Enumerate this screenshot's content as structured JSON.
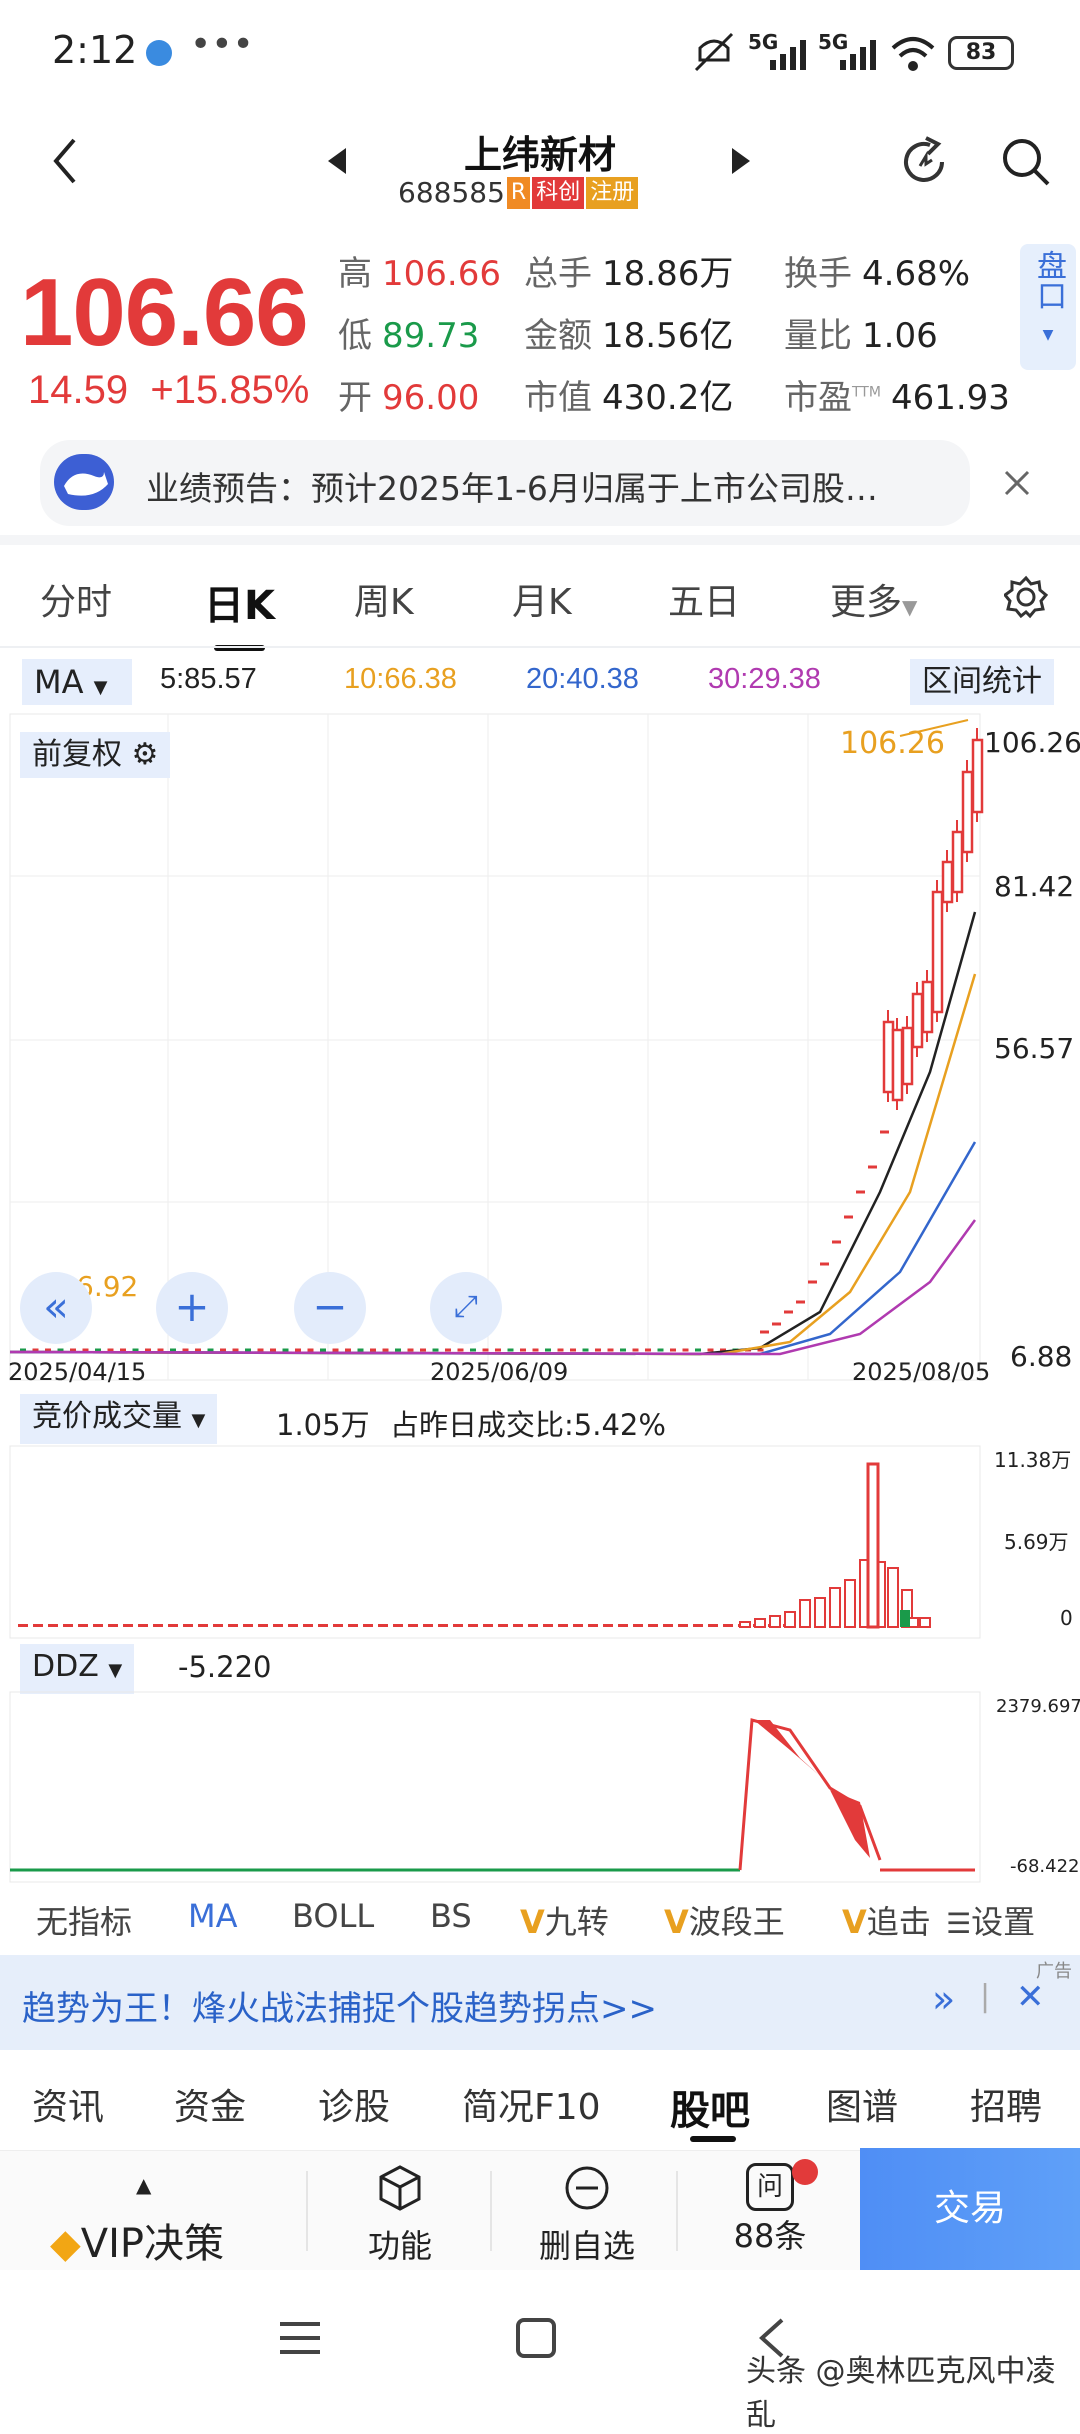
{
  "status_bar": {
    "time": "2:12",
    "dots": "•••",
    "net1": "5G",
    "net2": "5G",
    "battery": "83"
  },
  "header": {
    "title": "上纬新材",
    "code": "688585",
    "tag_r": "R",
    "tag_kc": "科创",
    "tag_zc": "注册"
  },
  "quote": {
    "price": "106.66",
    "change": "14.59",
    "change_pct": "+15.85%",
    "high_label": "高",
    "high": "106.66",
    "low_label": "低",
    "low": "89.73",
    "open_label": "开",
    "open": "96.00",
    "vol_label": "总手",
    "vol": "18.86万",
    "amount_label": "金额",
    "amount": "18.56亿",
    "mcap_label": "市值",
    "mcap": "430.2亿",
    "turnover_label": "换手",
    "turnover": "4.68%",
    "vratio_label": "量比",
    "vratio": "1.06",
    "pe_label": "市盈",
    "pe_sup": "TTM",
    "pe": "461.93",
    "pankou": "盘口"
  },
  "notice": {
    "text": "业绩预告：预计2025年1-6月归属于上市公司股…"
  },
  "tabs": [
    "分时",
    "日K",
    "周K",
    "月K",
    "五日",
    "更多"
  ],
  "ma": {
    "label": "MA",
    "ma5": "5:85.57",
    "ma10": "10:66.38",
    "ma20": "20:40.38",
    "ma30": "30:29.38",
    "range_stat": "区间统计",
    "fuquan": "前复权",
    "colors": {
      "ma5": "#222222",
      "ma10": "#e8a020",
      "ma20": "#3366cc",
      "ma30": "#b03ab0",
      "up": "#e23a3a",
      "down": "#1a9a4a"
    }
  },
  "kchart": {
    "price_axis": [
      "106.26",
      "81.42",
      "56.57",
      "6.88"
    ],
    "max_label": "106.26",
    "min_label": "6.92",
    "dates": [
      "2025/04/15",
      "2025/06/09",
      "2025/08/05"
    ]
  },
  "volume": {
    "label": "竞价成交量",
    "value": "1.05万",
    "ratio": "占昨日成交比:5.42%",
    "axis": [
      "11.38万",
      "5.69万",
      "0"
    ]
  },
  "ddz": {
    "label": "DDZ",
    "value": "-5.220",
    "axis": [
      "2379.697",
      "-68.422"
    ]
  },
  "indicators": [
    "无指标",
    "MA",
    "BOLL",
    "BS",
    "九转",
    "波段王",
    "追击",
    "设置"
  ],
  "ad": {
    "text": "趋势为王！烽火战法捕捉个股趋势拐点>>",
    "badge": "广告"
  },
  "nav_tabs": [
    "资讯",
    "资金",
    "诊股",
    "简况F10",
    "股吧",
    "图谱",
    "招聘"
  ],
  "bottom": {
    "vip": "VIP决策",
    "func": "功能",
    "del": "删自选",
    "count": "88条",
    "ask": "问",
    "trade": "交易"
  },
  "watermark": "头条 @奥林匹克风中凌乱"
}
